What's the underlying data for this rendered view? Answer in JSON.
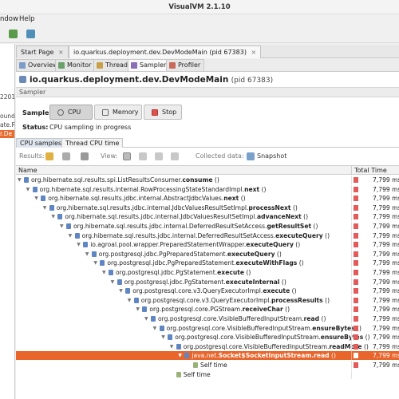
{
  "window": {
    "title": "VisualVM 2.1.10"
  },
  "menu": {
    "window_label": "ndow",
    "help_label": "Help"
  },
  "left_pane": {
    "items": [
      "2201",
      "ound",
      "ate.R",
      "r.De"
    ],
    "selected_index": 3
  },
  "doc_tabs": [
    {
      "label": "Start Page",
      "closable": true,
      "active": false
    },
    {
      "label": "io.quarkus.deployment.dev.DevModeMain (pid 67383)",
      "closable": true,
      "active": true
    }
  ],
  "sub_tabs": [
    {
      "label": "Overview",
      "icon": "overview-icon",
      "active": false
    },
    {
      "label": "Monitor",
      "icon": "monitor-icon",
      "active": false
    },
    {
      "label": "Threads",
      "icon": "threads-icon",
      "active": false
    },
    {
      "label": "Sampler",
      "icon": "sampler-icon",
      "active": true
    },
    {
      "label": "Profiler",
      "icon": "profiler-icon",
      "active": false
    }
  ],
  "app": {
    "name": "io.quarkus.deployment.dev.DevModeMain",
    "pid": "(pid 67383)"
  },
  "sampler_section": {
    "title": "Sampler"
  },
  "controls": {
    "sample_label": "Sample:",
    "cpu_button": "CPU",
    "memory_button": "Memory",
    "stop_button": "Stop",
    "status_label": "Status:",
    "status_value": "CPU sampling in progress"
  },
  "result_tabs": [
    {
      "label": "CPU samples",
      "active": true
    },
    {
      "label": "Thread CPU time",
      "active": false
    }
  ],
  "results_bar": {
    "results_label": "Results:",
    "view_label": "View:",
    "collected_label": "Collected data:",
    "snapshot_label": "Snapshot"
  },
  "table": {
    "col_name": "Name",
    "col_time": "Total Time",
    "rows": [
      {
        "depth": 0,
        "expanded": true,
        "prefix": "org.hibernate.sql.results.spi.ListResultsConsumer.",
        "method": "consume",
        "args": " ()",
        "time": "7,799 ms",
        "selected": false
      },
      {
        "depth": 1,
        "expanded": true,
        "prefix": "org.hibernate.sql.results.internal.RowProcessingStateStandardImpl.",
        "method": "next",
        "args": " ()",
        "time": "7,799 ms",
        "selected": false
      },
      {
        "depth": 2,
        "expanded": true,
        "prefix": "org.hibernate.sql.results.jdbc.internal.AbstractJdbcValues.",
        "method": "next",
        "args": " ()",
        "time": "7,799 ms",
        "selected": false
      },
      {
        "depth": 3,
        "expanded": true,
        "prefix": "org.hibernate.sql.results.jdbc.internal.JdbcValuesResultSetImpl.",
        "method": "processNext",
        "args": " ()",
        "time": "7,799 ms",
        "selected": false
      },
      {
        "depth": 4,
        "expanded": true,
        "prefix": "org.hibernate.sql.results.jdbc.internal.JdbcValuesResultSetImpl.",
        "method": "advanceNext",
        "args": " ()",
        "time": "7,799 ms",
        "selected": false
      },
      {
        "depth": 5,
        "expanded": true,
        "prefix": "org.hibernate.sql.results.jdbc.internal.DeferredResultSetAccess.",
        "method": "getResultSet",
        "args": " ()",
        "time": "7,799 ms",
        "selected": false
      },
      {
        "depth": 6,
        "expanded": true,
        "prefix": "org.hibernate.sql.results.jdbc.internal.DeferredResultSetAccess.",
        "method": "executeQuery",
        "args": " ()",
        "time": "7,799 ms",
        "selected": false
      },
      {
        "depth": 7,
        "expanded": true,
        "prefix": "io.agroal.pool.wrapper.PreparedStatementWrapper.",
        "method": "executeQuery",
        "args": " ()",
        "time": "7,799 ms",
        "selected": false
      },
      {
        "depth": 8,
        "expanded": true,
        "prefix": "org.postgresql.jdbc.PgPreparedStatement.",
        "method": "executeQuery",
        "args": " ()",
        "time": "7,799 ms",
        "selected": false
      },
      {
        "depth": 9,
        "expanded": true,
        "prefix": "org.postgresql.jdbc.PgPreparedStatement.",
        "method": "executeWithFlags",
        "args": " ()",
        "time": "7,799 ms",
        "selected": false
      },
      {
        "depth": 10,
        "expanded": true,
        "prefix": "org.postgresql.jdbc.PgStatement.",
        "method": "execute",
        "args": " ()",
        "time": "7,799 ms",
        "selected": false
      },
      {
        "depth": 11,
        "expanded": true,
        "prefix": "org.postgresql.jdbc.PgStatement.",
        "method": "executeInternal",
        "args": " ()",
        "time": "7,799 ms",
        "selected": false
      },
      {
        "depth": 12,
        "expanded": true,
        "prefix": "org.postgresql.core.v3.QueryExecutorImpl.",
        "method": "execute",
        "args": " ()",
        "time": "7,799 ms",
        "selected": false
      },
      {
        "depth": 13,
        "expanded": true,
        "prefix": "org.postgresql.core.v3.QueryExecutorImpl.",
        "method": "processResults",
        "args": " ()",
        "time": "7,799 ms",
        "selected": false
      },
      {
        "depth": 14,
        "expanded": true,
        "prefix": "org.postgresql.core.PGStream.",
        "method": "receiveChar",
        "args": " ()",
        "time": "7,799 ms",
        "selected": false
      },
      {
        "depth": 15,
        "expanded": true,
        "prefix": "org.postgresql.core.VisibleBufferedInputStream.",
        "method": "read",
        "args": " ()",
        "time": "7,799 ms",
        "selected": false
      },
      {
        "depth": 16,
        "expanded": true,
        "prefix": "org.postgresql.core.VisibleBufferedInputStream.",
        "method": "ensureBytes",
        "args": " ()",
        "time": "7,799 ms",
        "selected": false
      },
      {
        "depth": 17,
        "expanded": true,
        "prefix": "org.postgresql.core.VisibleBufferedInputStream.",
        "method": "ensureBytes",
        "args": " ()",
        "time": "7,799 ms",
        "selected": false
      },
      {
        "depth": 18,
        "expanded": true,
        "prefix": "org.postgresql.core.VisibleBufferedInputStream.",
        "method": "readMore",
        "args": " ()",
        "time": "7,799 ms",
        "selected": false
      },
      {
        "depth": 19,
        "expanded": true,
        "prefix": "java.net.",
        "method": "Socket$SocketInputStream.read",
        "args": " ()",
        "time": "7,799 ms",
        "selected": true
      },
      {
        "depth": 20,
        "expanded": false,
        "prefix": "",
        "method": "",
        "args": "Self time",
        "time": "7,799 ms",
        "selected": false
      },
      {
        "depth": 18,
        "expanded": false,
        "prefix": "",
        "method": "",
        "args": "Self time",
        "time": "",
        "selected": false
      }
    ]
  },
  "colors": {
    "selection": "#e8652b",
    "time_bar": "#e35a5a",
    "method_icon": "#5f86c2"
  }
}
